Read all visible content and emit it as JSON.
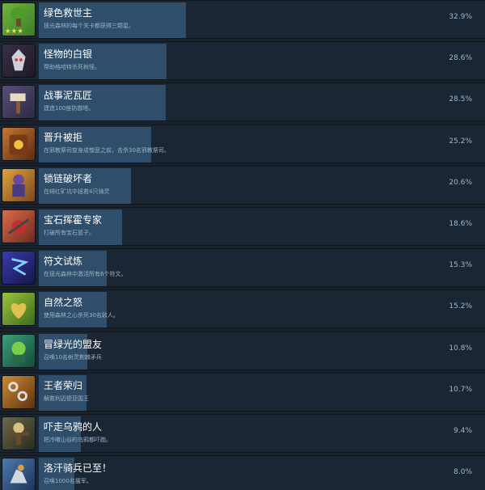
{
  "achievements": [
    {
      "title": "绿色救世主",
      "description": "拯光森林的每个关卡都获得三颗星。",
      "percent_label": "32.9%",
      "percent": 32.9,
      "icon": "tree-stars-icon",
      "colors": [
        "#6fb33a",
        "#3e7d2a"
      ]
    },
    {
      "title": "怪物的白银",
      "description": "帮助格哈特杀死树怪。",
      "percent_label": "28.6%",
      "percent": 28.6,
      "icon": "monster-icon",
      "colors": [
        "#3a2f4a",
        "#1c1a24"
      ]
    },
    {
      "title": "战事泥瓦匠",
      "description": "建造100座防御塔。",
      "percent_label": "28.5%",
      "percent": 28.5,
      "icon": "hammer-icon",
      "colors": [
        "#5a4e7a",
        "#2d2a44"
      ]
    },
    {
      "title": "晋升被拒",
      "description": "在邪教祭司变身成憎恶之前，击杀30名邪教祭司。",
      "percent_label": "25.2%",
      "percent": 25.2,
      "icon": "cultist-book-icon",
      "colors": [
        "#c7762d",
        "#5a2d14"
      ]
    },
    {
      "title": "锁链破坏者",
      "description": "在绯红矿坑中拯救4只骑灵",
      "percent_label": "20.6%",
      "percent": 20.6,
      "icon": "chain-hero-icon",
      "colors": [
        "#e0a23a",
        "#7a4a1c"
      ]
    },
    {
      "title": "宝石挥霍专家",
      "description": "打破所有宝石篮子。",
      "percent_label": "18.6%",
      "percent": 18.6,
      "icon": "gem-basket-icon",
      "colors": [
        "#e06a4a",
        "#6a2a22"
      ]
    },
    {
      "title": "符文试炼",
      "description": "在拯光森林中激活所有6个符文。",
      "percent_label": "15.3%",
      "percent": 15.3,
      "icon": "rune-icon",
      "colors": [
        "#3a3ab0",
        "#16164a"
      ]
    },
    {
      "title": "自然之怒",
      "description": "使用森林之心杀死30名敌人。",
      "percent_label": "15.2%",
      "percent": 15.2,
      "icon": "nature-heart-icon",
      "colors": [
        "#9ac43a",
        "#3e6a1e"
      ]
    },
    {
      "title": "冒绿光的盟友",
      "description": "召唤10名树灵荆棘矛兵",
      "percent_label": "10.8%",
      "percent": 10.8,
      "icon": "green-ally-icon",
      "colors": [
        "#3aa07a",
        "#164a3a"
      ]
    },
    {
      "title": "王者荣归",
      "description": "解救利迈德亚国王",
      "percent_label": "10.7%",
      "percent": 10.7,
      "icon": "chain-king-icon",
      "colors": [
        "#d08a30",
        "#5a3414"
      ]
    },
    {
      "title": "吓走乌鸦的人",
      "description": "把冷嗽山谷的乌鸦都吓跑。",
      "percent_label": "9.4%",
      "percent": 9.4,
      "icon": "scarecrow-icon",
      "colors": [
        "#6a6a4a",
        "#2a2a1e"
      ]
    },
    {
      "title": "洛汗骑兵已至！",
      "description": "召唤1000名援军。",
      "percent_label": "8.0%",
      "percent": 8.0,
      "icon": "cavalry-icon",
      "colors": [
        "#4a7ab0",
        "#1e3456"
      ]
    }
  ]
}
